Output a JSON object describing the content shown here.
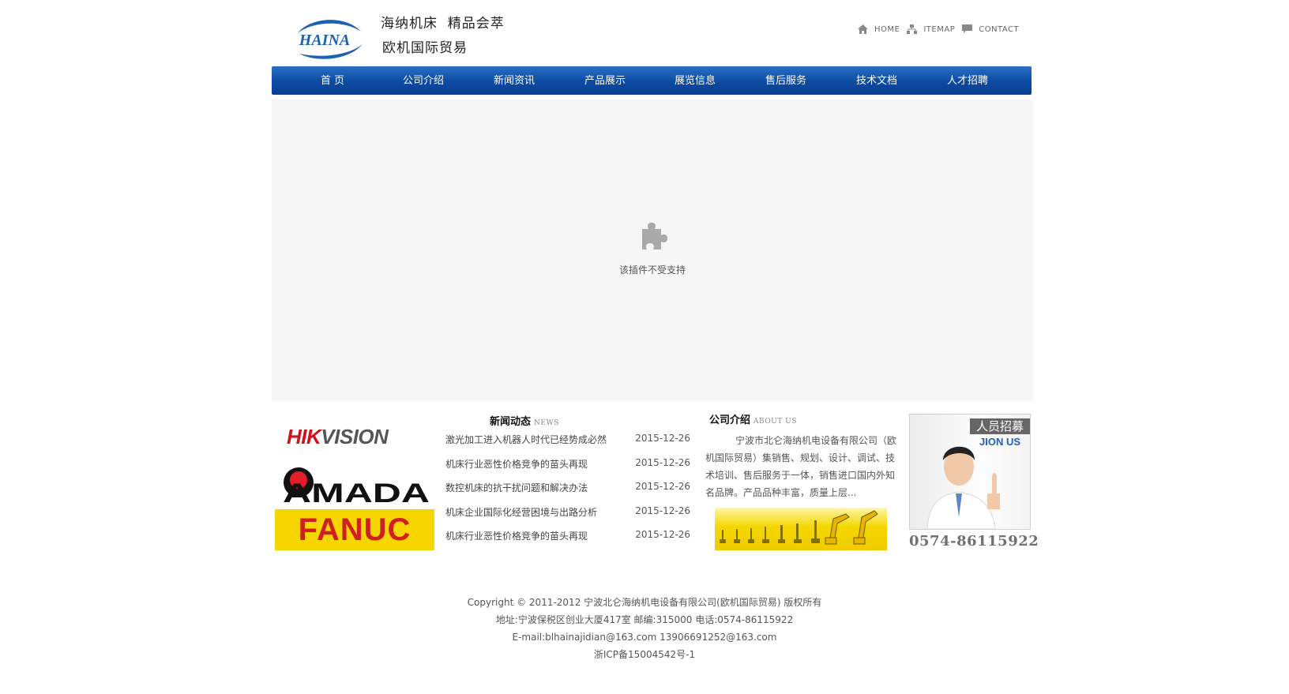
{
  "header": {
    "logo_text": "HAINA",
    "slogan_line1": "海纳机床  精品会萃",
    "slogan_line2": "欧机国际贸易",
    "top_links": [
      "HOME",
      "ITEMAP",
      "CONTACT"
    ]
  },
  "nav": {
    "items": [
      "首 页",
      "公司介绍",
      "新闻资讯",
      "产品展示",
      "展览信息",
      "售后服务",
      "技术文档",
      "人才招聘"
    ]
  },
  "plugin": {
    "message": "该插件不受支持"
  },
  "brands": {
    "hikvision": {
      "red": "HIK",
      "gray": "VISION"
    },
    "amada": "AMADA",
    "fanuc": "FANUC"
  },
  "news": {
    "title": "新闻动态",
    "title_en": "NEWS",
    "items": [
      {
        "title": "激光加工进入机器人时代已经势成必然",
        "date": "2015-12-26"
      },
      {
        "title": "机床行业恶性价格竞争的苗头再现",
        "date": "2015-12-26"
      },
      {
        "title": "数控机床的抗干扰问题和解决办法",
        "date": "2015-12-26"
      },
      {
        "title": "机床企业国际化经营困境与出路分析",
        "date": "2015-12-26"
      },
      {
        "title": "机床行业恶性价格竞争的苗头再现",
        "date": "2015-12-26"
      }
    ]
  },
  "about": {
    "title": "公司介绍",
    "title_en": "ABOUT US",
    "text": "宁波市北仑海纳机电设备有限公司（欧机国际贸易）集销售、规划、设计、调试、技术培训、售后服务于一体，销售进口国内外知名品牌。产品品种丰富，质量上层..."
  },
  "recruit": {
    "title": "人员招募",
    "subtitle": "JION US",
    "phone": "0574-86115922"
  },
  "footer": {
    "line1": "Copyright © 2011-2012 宁波北仑海纳机电设备有限公司(欧机国际贸易) 版权所有",
    "line2": "地址:宁波保税区创业大厦417室 邮编:315000 电话:0574-86115922",
    "line3": "E-mail:blhainajidian@163.com 13906691252@163.com",
    "line4": "浙ICP备15004542号-1"
  },
  "colors": {
    "nav_blue": "#0b4aa1",
    "logo_blue": "#1d61b2",
    "fanuc_yellow": "#f7d500",
    "fanuc_red": "#d01f1f",
    "hik_red": "#d1121e"
  }
}
